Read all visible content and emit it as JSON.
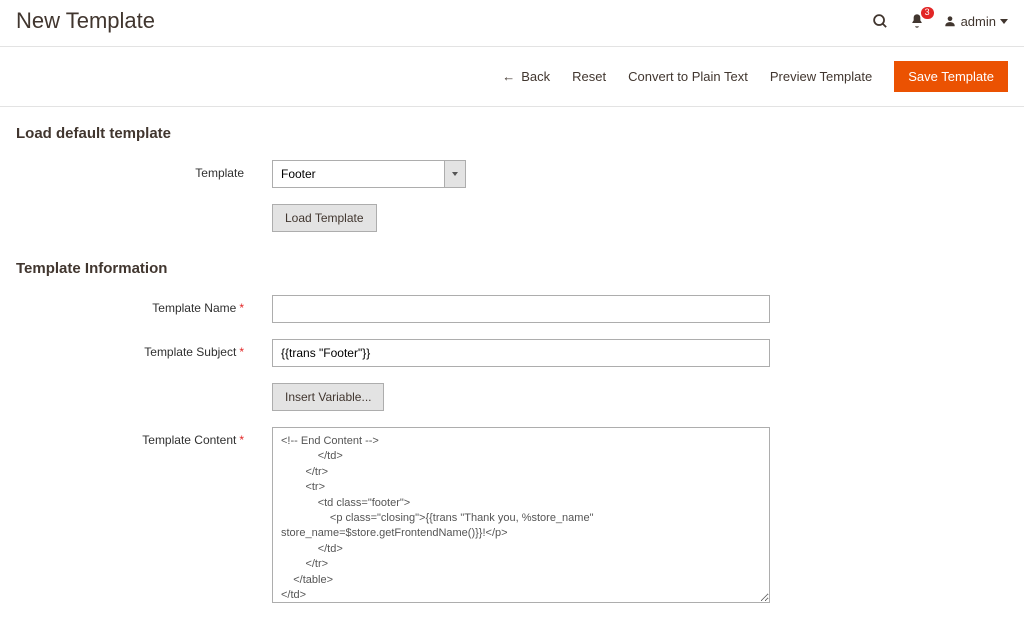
{
  "header": {
    "title": "New Template",
    "notification_count": "3",
    "admin_label": "admin"
  },
  "actions": {
    "back": "Back",
    "reset": "Reset",
    "convert": "Convert to Plain Text",
    "preview": "Preview Template",
    "save": "Save Template"
  },
  "sections": {
    "load_default": "Load default template",
    "template_info": "Template Information"
  },
  "labels": {
    "template": "Template",
    "load_template": "Load Template",
    "template_name": "Template Name",
    "template_subject": "Template Subject",
    "insert_variable": "Insert Variable...",
    "template_content": "Template Content"
  },
  "fields": {
    "template_select": "Footer",
    "template_name_value": "",
    "template_subject_value": "{{trans \"Footer\"}}",
    "template_content_value": "<!-- End Content -->\n            </td>\n        </tr>\n        <tr>\n            <td class=\"footer\">\n                <p class=\"closing\">{{trans \"Thank you, %store_name\" store_name=$store.getFrontendName()}}!</p>\n            </td>\n        </tr>\n    </table>\n</td>\n</tr>\n</table>\n<!-- End wrapper table -->\n</body>"
  }
}
